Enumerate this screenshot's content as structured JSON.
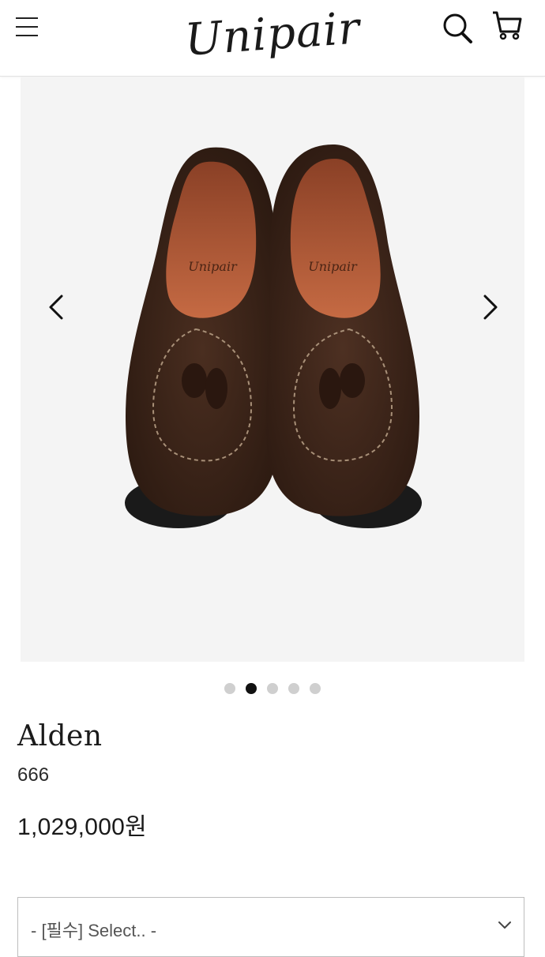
{
  "header": {
    "logo": "Unipair",
    "menu_icon": "hamburger-menu-icon",
    "search_icon": "search-icon",
    "cart_icon": "cart-icon"
  },
  "gallery": {
    "prev_icon": "chevron-left-icon",
    "next_icon": "chevron-right-icon",
    "slide_count": 5,
    "active_slide": 2,
    "insole_stamp": "Unipair"
  },
  "product": {
    "brand": "Alden",
    "model": "666",
    "price": "1,029,000원"
  },
  "options": {
    "select_placeholder": "- [필수] Select.. -",
    "chevron_icon": "chevron-down-icon"
  },
  "colors": {
    "accent": "#111111",
    "dot_inactive": "#cfcfcf",
    "suede": "#3b2418",
    "lining": "#a0522d"
  }
}
